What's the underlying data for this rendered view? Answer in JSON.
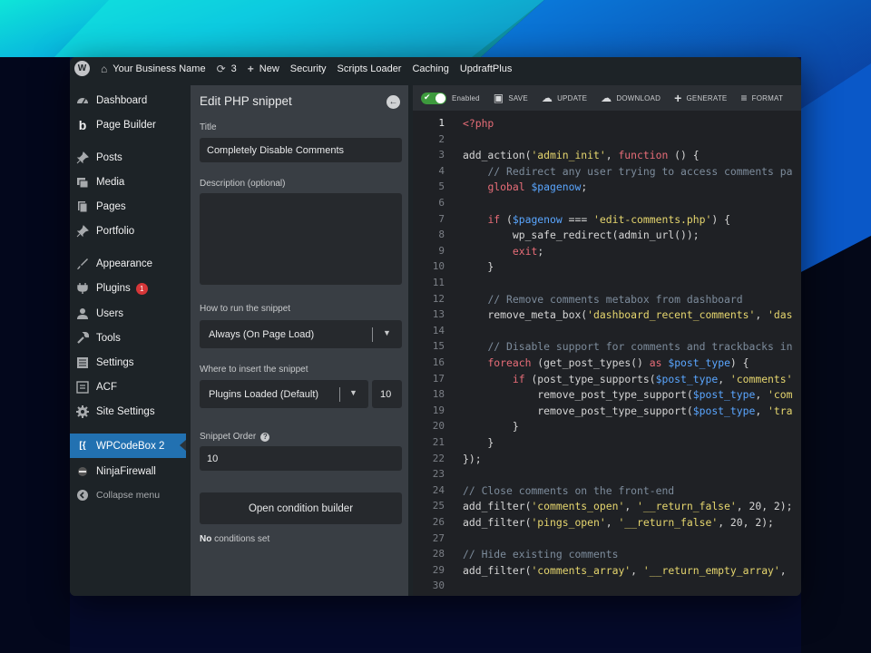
{
  "admin_bar": {
    "site_name": "Your Business Name",
    "updates_count": "3",
    "new_label": "New",
    "menu": [
      "Security",
      "Scripts Loader",
      "Caching",
      "UpdraftPlus"
    ]
  },
  "sidebar": {
    "items": [
      {
        "label": "Dashboard",
        "icon": "dashboard-icon"
      },
      {
        "label": "Page Builder",
        "icon": "page-builder-icon"
      },
      {
        "label": "Posts",
        "icon": "pin-icon"
      },
      {
        "label": "Media",
        "icon": "media-icon"
      },
      {
        "label": "Pages",
        "icon": "pages-icon"
      },
      {
        "label": "Portfolio",
        "icon": "pin-icon"
      },
      {
        "label": "Appearance",
        "icon": "brush-icon"
      },
      {
        "label": "Plugins",
        "icon": "plugin-icon",
        "badge": "1"
      },
      {
        "label": "Users",
        "icon": "user-icon"
      },
      {
        "label": "Tools",
        "icon": "wrench-icon"
      },
      {
        "label": "Settings",
        "icon": "settings-icon"
      },
      {
        "label": "ACF",
        "icon": "acf-icon"
      },
      {
        "label": "Site Settings",
        "icon": "gear-icon"
      },
      {
        "label": "WPCodeBox 2",
        "icon": "codebox-icon",
        "active": true
      },
      {
        "label": "NinjaFirewall",
        "icon": "ninja-icon"
      }
    ],
    "collapse_label": "Collapse menu"
  },
  "panel": {
    "title": "Edit PHP snippet",
    "title_label": "Title",
    "title_value": "Completely Disable Comments",
    "description_label": "Description (optional)",
    "description_value": "",
    "run_label": "How to run the snippet",
    "run_value": "Always (On Page Load)",
    "insert_label": "Where to insert the snippet",
    "insert_value": "Plugins Loaded (Default)",
    "insert_priority": "10",
    "order_label": "Snippet Order",
    "order_value": "10",
    "condition_button": "Open condition builder",
    "conditions_no": "No",
    "conditions_rest": " conditions set"
  },
  "toolbar": {
    "enabled_label": "Enabled",
    "save": "SAVE",
    "update": "UPDATE",
    "download": "DOWNLOAD",
    "generate": "GENERATE",
    "format": "FORMAT"
  },
  "code": [
    "<?php",
    "",
    "add_action('admin_init', function () {",
    "    // Redirect any user trying to access comments pa",
    "    global $pagenow;",
    "",
    "    if ($pagenow === 'edit-comments.php') {",
    "        wp_safe_redirect(admin_url());",
    "        exit;",
    "    }",
    "",
    "    // Remove comments metabox from dashboard",
    "    remove_meta_box('dashboard_recent_comments', 'das",
    "",
    "    // Disable support for comments and trackbacks in",
    "    foreach (get_post_types() as $post_type) {",
    "        if (post_type_supports($post_type, 'comments'",
    "            remove_post_type_support($post_type, 'com",
    "            remove_post_type_support($post_type, 'tra",
    "        }",
    "    }",
    "});",
    "",
    "// Close comments on the front-end",
    "add_filter('comments_open', '__return_false', 20, 2);",
    "add_filter('pings_open', '__return_false', 20, 2);",
    "",
    "// Hide existing comments",
    "add_filter('comments_array', '__return_empty_array',",
    ""
  ]
}
